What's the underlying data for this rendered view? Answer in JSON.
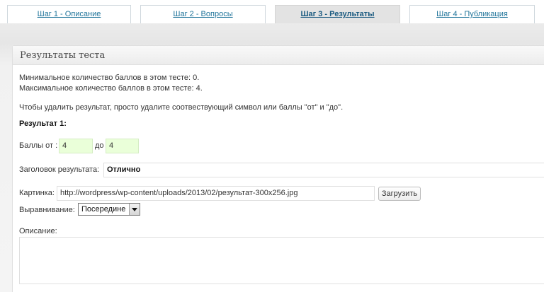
{
  "tabs": [
    {
      "label": "Шаг 1 - Описание",
      "active": false
    },
    {
      "label": "Шаг 2 - Вопросы",
      "active": false
    },
    {
      "label": "Шаг 3 - Результаты",
      "active": true
    },
    {
      "label": "Шаг 4 - Публикация",
      "active": false
    }
  ],
  "panel": {
    "title": "Результаты теста",
    "min_line": "Минимальное количество баллов в этом тесте: 0.",
    "max_line": "Максимальное количество баллов в этом тесте: 4.",
    "hint": "Чтобы удалить результат, просто удалите соотвествующий символ или баллы \"от\" и \"до\".",
    "result_heading": "Результат 1:",
    "score_from_label": "Баллы от :",
    "score_from_value": "4",
    "score_to_label": "до",
    "score_to_value": "4",
    "result_title_label": "Заголовок результата:",
    "result_title_value": "Отлично",
    "image_label": "Картинка:",
    "image_value": "http://wordpress/wp-content/uploads/2013/02/результат-300x256.jpg",
    "upload_button": "Загрузить",
    "align_label": "Выравнивание:",
    "align_value": "Посередине",
    "description_label": "Описание:",
    "description_value": ""
  },
  "colors": {
    "link": "#21759b",
    "green_field": "#eaffd9"
  }
}
